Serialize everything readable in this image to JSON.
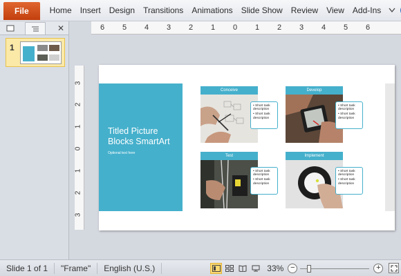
{
  "ribbon": {
    "file_label": "File",
    "tabs": [
      "Home",
      "Insert",
      "Design",
      "Transitions",
      "Animations",
      "Slide Show",
      "Review",
      "View",
      "Add-Ins"
    ],
    "caret_icon": "chevron-down-icon",
    "help_label": "?"
  },
  "pane": {
    "close_label": "✕",
    "slide_number": "1"
  },
  "hruler": {
    "ticks": [
      "6",
      "5",
      "4",
      "3",
      "2",
      "1",
      "0",
      "1",
      "2",
      "3",
      "4",
      "5",
      "6"
    ]
  },
  "vruler": {
    "ticks": [
      "3",
      "2",
      "1",
      "0",
      "1",
      "2",
      "3"
    ]
  },
  "slide": {
    "title": "Titled Picture Blocks SmartArt",
    "subtitle": "Optional text here",
    "accent_color": "#45b0cc",
    "blocks": [
      {
        "title": "Conceive",
        "desc": [
          "Short task description",
          "Short task description"
        ]
      },
      {
        "title": "Develop",
        "desc": [
          "Short task description",
          "Short task description"
        ]
      },
      {
        "title": "Test",
        "desc": [
          "Short task description",
          "Short task description"
        ]
      },
      {
        "title": "Implement",
        "desc": [
          "Short task description",
          "Short task description"
        ]
      }
    ]
  },
  "status": {
    "slide_info": "Slide 1 of 1",
    "theme": "\"Frame\"",
    "language": "English (U.S.)",
    "zoom": "33%",
    "zoom_fraction": 0.33,
    "view_icons": [
      "normal-view-icon",
      "slide-sorter-icon",
      "reading-view-icon",
      "slide-show-icon"
    ]
  }
}
